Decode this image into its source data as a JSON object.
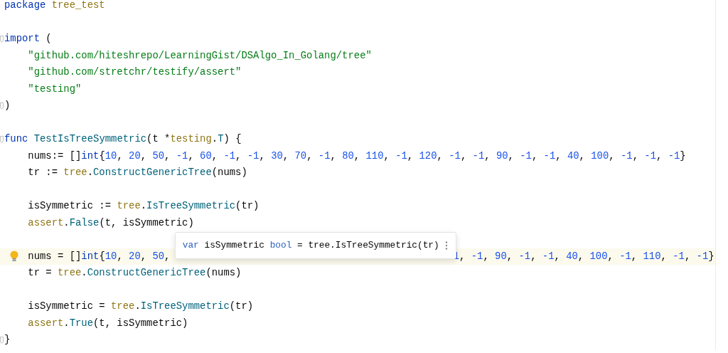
{
  "tooltip": {
    "tokens": [
      {
        "kind": "kw",
        "text": "var"
      },
      {
        "kind": "plain",
        "text": " isSymmetric "
      },
      {
        "kind": "kw",
        "text": "bool"
      },
      {
        "kind": "plain",
        "text": " = tree.IsTreeSymmetric(tr)"
      }
    ]
  },
  "lines": [
    {
      "indented": false,
      "fold": false,
      "current": false,
      "bulb": false,
      "tokens": [
        {
          "kind": "kw",
          "text": "package "
        },
        {
          "kind": "pkg",
          "text": "tree_test"
        }
      ]
    },
    {
      "fold": false,
      "current": false,
      "bulb": false
    },
    {
      "indented": false,
      "fold": true,
      "current": false,
      "bulb": false,
      "tokens": [
        {
          "kind": "kw",
          "text": "import"
        },
        {
          "kind": "plain",
          "text": " ("
        }
      ]
    },
    {
      "indented": true,
      "fold": false,
      "current": false,
      "bulb": false,
      "tokens": [
        {
          "kind": "str",
          "text": "\"github.com/hiteshrepo/LearningGist/DSAlgo_In_Golang/tree\""
        }
      ]
    },
    {
      "indented": true,
      "fold": false,
      "current": false,
      "bulb": false,
      "tokens": [
        {
          "kind": "str",
          "text": "\"github.com/stretchr/testify/assert\""
        }
      ]
    },
    {
      "indented": true,
      "fold": false,
      "current": false,
      "bulb": false,
      "tokens": [
        {
          "kind": "str",
          "text": "\"testing\""
        }
      ]
    },
    {
      "indented": false,
      "fold": true,
      "current": false,
      "bulb": false,
      "tokens": [
        {
          "kind": "plain",
          "text": ")"
        }
      ]
    },
    {
      "fold": false,
      "current": false,
      "bulb": false
    },
    {
      "indented": false,
      "fold": true,
      "current": false,
      "bulb": false,
      "tokens": [
        {
          "kind": "kw",
          "text": "func "
        },
        {
          "kind": "fn",
          "text": "TestIsTreeSymmetric"
        },
        {
          "kind": "plain",
          "text": "(t *"
        },
        {
          "kind": "pkg",
          "text": "testing"
        },
        {
          "kind": "plain",
          "text": "."
        },
        {
          "kind": "fn",
          "text": "T"
        },
        {
          "kind": "plain",
          "text": ") {"
        }
      ]
    },
    {
      "indented": true,
      "fold": false,
      "current": false,
      "bulb": false,
      "tokens": [
        {
          "kind": "plain",
          "text": "nums:= []"
        },
        {
          "kind": "kw",
          "text": "int"
        },
        {
          "kind": "plain",
          "text": "{"
        },
        {
          "kind": "num",
          "text": "10"
        },
        {
          "kind": "plain",
          "text": ", "
        },
        {
          "kind": "num",
          "text": "20"
        },
        {
          "kind": "plain",
          "text": ", "
        },
        {
          "kind": "num",
          "text": "50"
        },
        {
          "kind": "plain",
          "text": ", "
        },
        {
          "kind": "num",
          "text": "-1"
        },
        {
          "kind": "plain",
          "text": ", "
        },
        {
          "kind": "num",
          "text": "60"
        },
        {
          "kind": "plain",
          "text": ", "
        },
        {
          "kind": "num",
          "text": "-1"
        },
        {
          "kind": "plain",
          "text": ", "
        },
        {
          "kind": "num",
          "text": "-1"
        },
        {
          "kind": "plain",
          "text": ", "
        },
        {
          "kind": "num",
          "text": "30"
        },
        {
          "kind": "plain",
          "text": ", "
        },
        {
          "kind": "num",
          "text": "70"
        },
        {
          "kind": "plain",
          "text": ", "
        },
        {
          "kind": "num",
          "text": "-1"
        },
        {
          "kind": "plain",
          "text": ", "
        },
        {
          "kind": "num",
          "text": "80"
        },
        {
          "kind": "plain",
          "text": ", "
        },
        {
          "kind": "num",
          "text": "110"
        },
        {
          "kind": "plain",
          "text": ", "
        },
        {
          "kind": "num",
          "text": "-1"
        },
        {
          "kind": "plain",
          "text": ", "
        },
        {
          "kind": "num",
          "text": "120"
        },
        {
          "kind": "plain",
          "text": ", "
        },
        {
          "kind": "num",
          "text": "-1"
        },
        {
          "kind": "plain",
          "text": ", "
        },
        {
          "kind": "num",
          "text": "-1"
        },
        {
          "kind": "plain",
          "text": ", "
        },
        {
          "kind": "num",
          "text": "90"
        },
        {
          "kind": "plain",
          "text": ", "
        },
        {
          "kind": "num",
          "text": "-1"
        },
        {
          "kind": "plain",
          "text": ", "
        },
        {
          "kind": "num",
          "text": "-1"
        },
        {
          "kind": "plain",
          "text": ", "
        },
        {
          "kind": "num",
          "text": "40"
        },
        {
          "kind": "plain",
          "text": ", "
        },
        {
          "kind": "num",
          "text": "100"
        },
        {
          "kind": "plain",
          "text": ", "
        },
        {
          "kind": "num",
          "text": "-1"
        },
        {
          "kind": "plain",
          "text": ", "
        },
        {
          "kind": "num",
          "text": "-1"
        },
        {
          "kind": "plain",
          "text": ", "
        },
        {
          "kind": "num",
          "text": "-1"
        },
        {
          "kind": "plain",
          "text": "}"
        }
      ]
    },
    {
      "indented": true,
      "fold": false,
      "current": false,
      "bulb": false,
      "tokens": [
        {
          "kind": "plain",
          "text": "tr := "
        },
        {
          "kind": "pkg",
          "text": "tree"
        },
        {
          "kind": "plain",
          "text": "."
        },
        {
          "kind": "fn",
          "text": "ConstructGenericTree"
        },
        {
          "kind": "plain",
          "text": "(nums)"
        }
      ]
    },
    {
      "fold": false,
      "current": false,
      "bulb": false
    },
    {
      "indented": true,
      "fold": false,
      "current": false,
      "bulb": false,
      "tokens": [
        {
          "kind": "plain",
          "text": "isSymmetric := "
        },
        {
          "kind": "pkg",
          "text": "tree"
        },
        {
          "kind": "plain",
          "text": "."
        },
        {
          "kind": "fn",
          "text": "IsTreeSymmetric"
        },
        {
          "kind": "plain",
          "text": "(tr)"
        }
      ]
    },
    {
      "indented": true,
      "fold": false,
      "current": false,
      "bulb": false,
      "tokens": [
        {
          "kind": "pkg",
          "text": "assert"
        },
        {
          "kind": "plain",
          "text": "."
        },
        {
          "kind": "fn",
          "text": "False"
        },
        {
          "kind": "plain",
          "text": "(t, isSymmetric)"
        }
      ]
    },
    {
      "fold": false,
      "current": false,
      "bulb": false
    },
    {
      "indented": true,
      "fold": false,
      "current": true,
      "bulb": true,
      "tokens": [
        {
          "kind": "plain",
          "text": "nums = []"
        },
        {
          "kind": "kw",
          "text": "int"
        },
        {
          "kind": "plain",
          "text": "{"
        },
        {
          "kind": "num",
          "text": "10"
        },
        {
          "kind": "plain",
          "text": ", "
        },
        {
          "kind": "num",
          "text": "20"
        },
        {
          "kind": "plain",
          "text": ", "
        },
        {
          "kind": "num",
          "text": "50"
        },
        {
          "kind": "plain",
          "text": ","
        },
        {
          "kind": "tooltip"
        },
        {
          "kind": "num",
          "text": "1"
        },
        {
          "kind": "plain",
          "text": ", "
        },
        {
          "kind": "num",
          "text": "-1"
        },
        {
          "kind": "plain",
          "text": ", "
        },
        {
          "kind": "num",
          "text": "90"
        },
        {
          "kind": "plain",
          "text": ", "
        },
        {
          "kind": "num",
          "text": "-1"
        },
        {
          "kind": "plain",
          "text": ", "
        },
        {
          "kind": "num",
          "text": "-1"
        },
        {
          "kind": "plain",
          "text": ", "
        },
        {
          "kind": "num",
          "text": "40"
        },
        {
          "kind": "plain",
          "text": ", "
        },
        {
          "kind": "num",
          "text": "100"
        },
        {
          "kind": "plain",
          "text": ", "
        },
        {
          "kind": "num",
          "text": "-1"
        },
        {
          "kind": "plain",
          "text": ", "
        },
        {
          "kind": "num",
          "text": "110"
        },
        {
          "kind": "plain",
          "text": ", "
        },
        {
          "kind": "num",
          "text": "-1"
        },
        {
          "kind": "plain",
          "text": ", "
        },
        {
          "kind": "num",
          "text": "-1"
        },
        {
          "kind": "plain",
          "text": "}"
        }
      ]
    },
    {
      "indented": true,
      "fold": false,
      "current": false,
      "bulb": false,
      "tokens": [
        {
          "kind": "plain",
          "text": "tr = "
        },
        {
          "kind": "pkg",
          "text": "tree"
        },
        {
          "kind": "plain",
          "text": "."
        },
        {
          "kind": "fn",
          "text": "ConstructGenericTree"
        },
        {
          "kind": "plain",
          "text": "(nums)"
        }
      ]
    },
    {
      "fold": false,
      "current": false,
      "bulb": false
    },
    {
      "indented": true,
      "fold": false,
      "current": false,
      "bulb": false,
      "tokens": [
        {
          "kind": "plain",
          "text": "isSymmetric = "
        },
        {
          "kind": "pkg",
          "text": "tree"
        },
        {
          "kind": "plain",
          "text": "."
        },
        {
          "kind": "fn",
          "text": "IsTreeSymmetric"
        },
        {
          "kind": "plain",
          "text": "(tr)"
        }
      ]
    },
    {
      "indented": true,
      "fold": false,
      "current": false,
      "bulb": false,
      "tokens": [
        {
          "kind": "pkg",
          "text": "assert"
        },
        {
          "kind": "plain",
          "text": "."
        },
        {
          "kind": "fn",
          "text": "True"
        },
        {
          "kind": "plain",
          "text": "(t, isSymmetric)"
        }
      ]
    },
    {
      "indented": false,
      "fold": true,
      "current": false,
      "bulb": false,
      "tokens": [
        {
          "kind": "plain",
          "text": "}"
        }
      ]
    }
  ]
}
